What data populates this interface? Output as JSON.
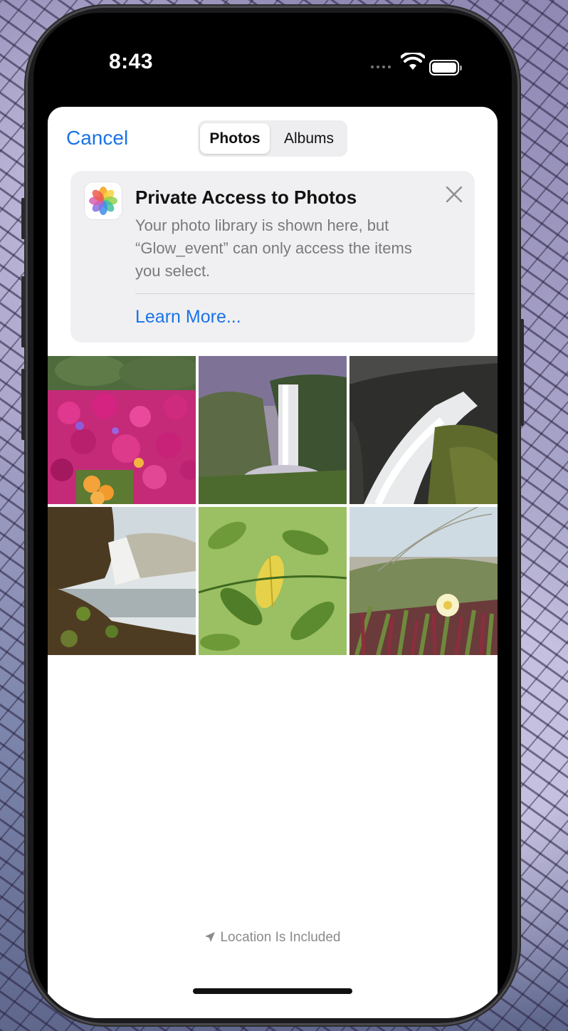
{
  "status_bar": {
    "time": "8:43",
    "icons": [
      "cellular-signal-icon",
      "wifi-icon",
      "battery-icon"
    ]
  },
  "nav": {
    "cancel_label": "Cancel",
    "segments": [
      "Photos",
      "Albums"
    ],
    "selected_segment": "Photos"
  },
  "banner": {
    "icon": "photos-app-icon",
    "title": "Private Access to Photos",
    "body": "Your photo library is shown here, but “Glow_event” can only access the items you select.",
    "link": "Learn More..."
  },
  "photos": [
    {
      "subject": "pink flowers"
    },
    {
      "subject": "waterfall valley"
    },
    {
      "subject": "waterfall rocks"
    },
    {
      "subject": "waterfall cliff"
    },
    {
      "subject": "green leaves"
    },
    {
      "subject": "ice plant flower"
    }
  ],
  "footer": {
    "location_label": "Location Is Included"
  },
  "colors": {
    "accent": "#1a73e8",
    "sheet": "#ffffff",
    "card": "#f0f0f2"
  }
}
